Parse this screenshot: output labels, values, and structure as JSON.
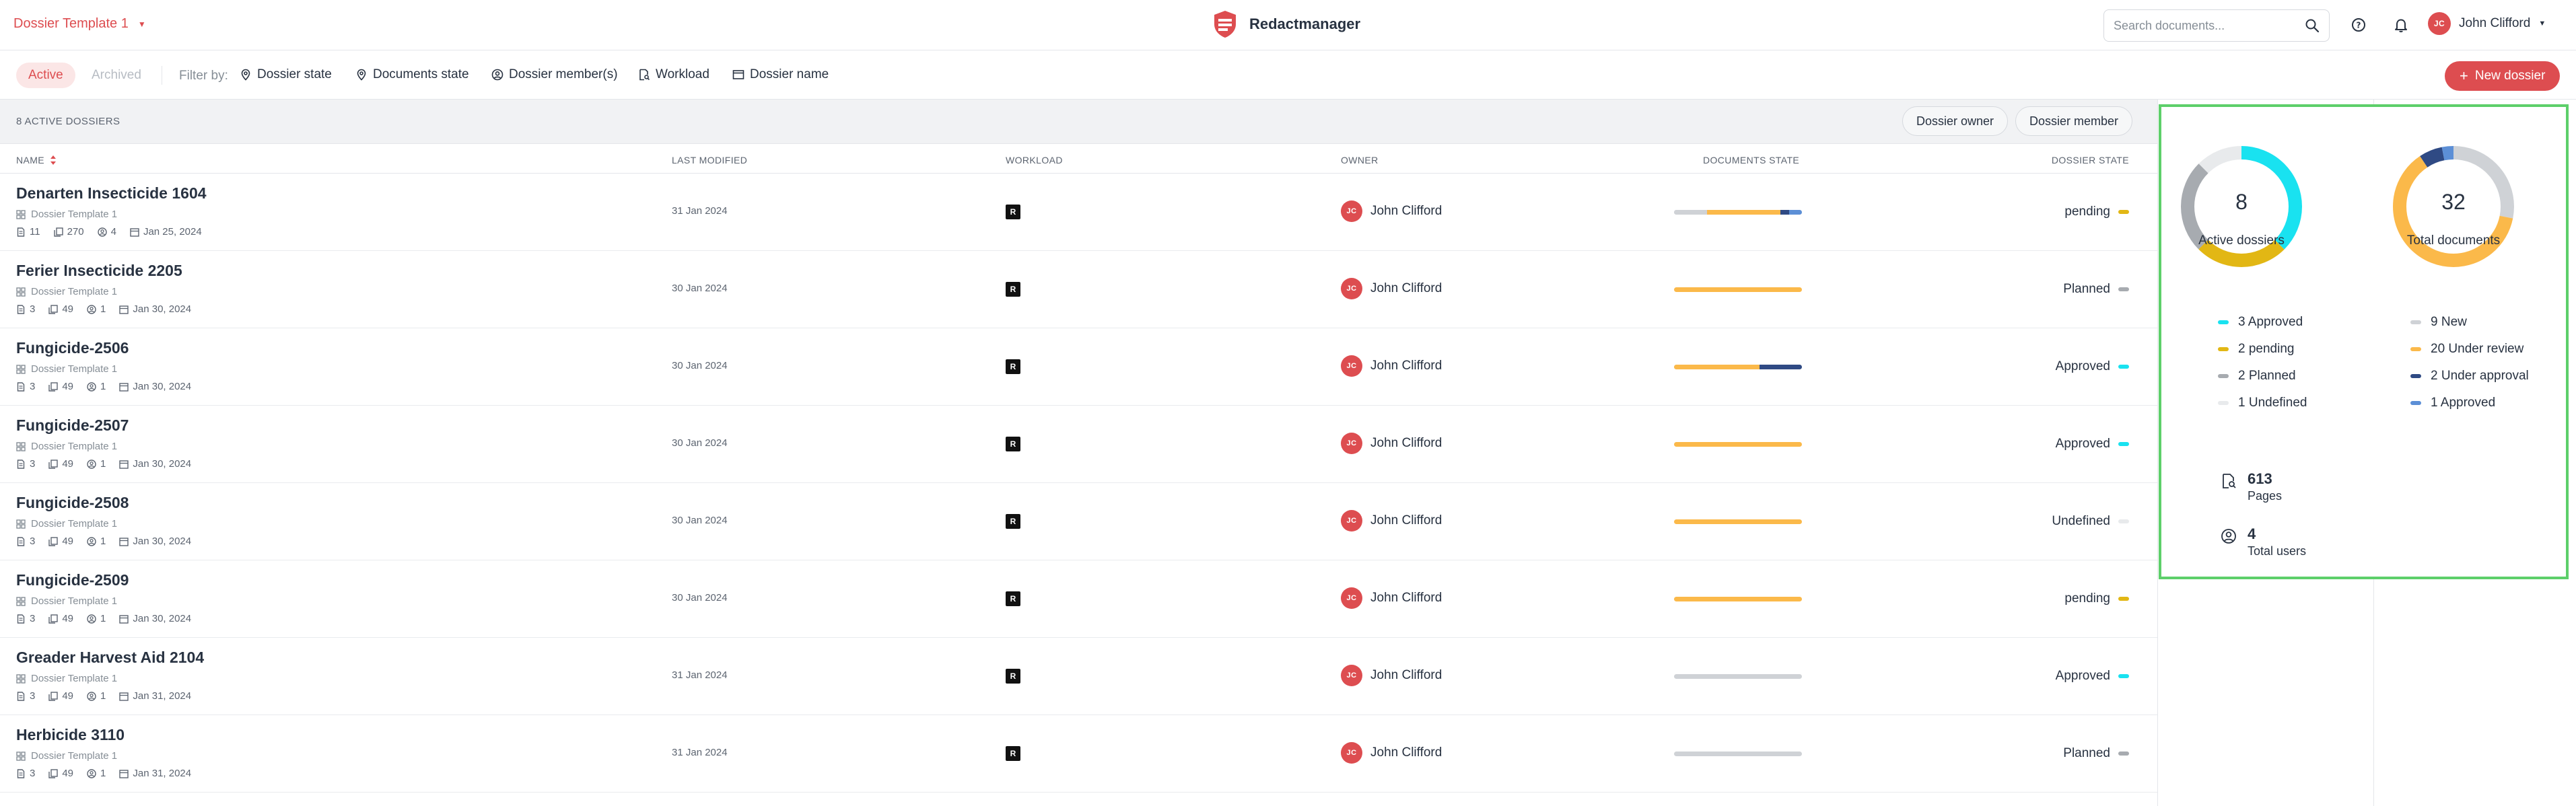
{
  "header": {
    "template_selector": "Dossier Template 1",
    "brand_name": "Redactmanager",
    "search_placeholder": "Search documents...",
    "user_initials": "JC",
    "user_name": "John Clifford"
  },
  "filterbar": {
    "tab_active": "Active",
    "tab_archived": "Archived",
    "filter_label": "Filter by:",
    "filters": [
      "Dossier state",
      "Documents state",
      "Dossier member(s)",
      "Workload",
      "Dossier name"
    ],
    "new_button": "New dossier"
  },
  "table": {
    "count_label": "8 ACTIVE DOSSIERS",
    "btn_owner": "Dossier owner",
    "btn_member": "Dossier member",
    "columns": [
      "NAME",
      "LAST MODIFIED",
      "WORKLOAD",
      "OWNER",
      "DOCUMENTS STATE",
      "DOSSIER STATE"
    ],
    "workload_badge": "R",
    "rows": [
      {
        "name": "Denarten Insecticide 1604",
        "template": "Dossier Template 1",
        "docs": "11",
        "pages": "270",
        "members": "4",
        "date": "Jan 25, 2024",
        "modified": "31 Jan 2024",
        "owner": "John Clifford",
        "owner_initials": "JC",
        "state": "pending",
        "state_color": "#e2b714",
        "bar": [
          [
            "#cfd2d6",
            26
          ],
          [
            "#fbb94a",
            57
          ],
          [
            "#2f4a84",
            7
          ],
          [
            "#5c8fd6",
            10
          ]
        ]
      },
      {
        "name": "Ferier Insecticide 2205",
        "template": "Dossier Template 1",
        "docs": "3",
        "pages": "49",
        "members": "1",
        "date": "Jan 30, 2024",
        "modified": "30 Jan 2024",
        "owner": "John Clifford",
        "owner_initials": "JC",
        "state": "Planned",
        "state_color": "#a7abb0",
        "bar": [
          [
            "#fbb94a",
            100
          ]
        ]
      },
      {
        "name": "Fungicide-2506",
        "template": "Dossier Template 1",
        "docs": "3",
        "pages": "49",
        "members": "1",
        "date": "Jan 30, 2024",
        "modified": "30 Jan 2024",
        "owner": "John Clifford",
        "owner_initials": "JC",
        "state": "Approved",
        "state_color": "#19e2f0",
        "bar": [
          [
            "#fbb94a",
            67
          ],
          [
            "#2f4a84",
            33
          ]
        ]
      },
      {
        "name": "Fungicide-2507",
        "template": "Dossier Template 1",
        "docs": "3",
        "pages": "49",
        "members": "1",
        "date": "Jan 30, 2024",
        "modified": "30 Jan 2024",
        "owner": "John Clifford",
        "owner_initials": "JC",
        "state": "Approved",
        "state_color": "#19e2f0",
        "bar": [
          [
            "#fbb94a",
            100
          ]
        ]
      },
      {
        "name": "Fungicide-2508",
        "template": "Dossier Template 1",
        "docs": "3",
        "pages": "49",
        "members": "1",
        "date": "Jan 30, 2024",
        "modified": "30 Jan 2024",
        "owner": "John Clifford",
        "owner_initials": "JC",
        "state": "Undefined",
        "state_color": "#e8eaec",
        "bar": [
          [
            "#fbb94a",
            100
          ]
        ]
      },
      {
        "name": "Fungicide-2509",
        "template": "Dossier Template 1",
        "docs": "3",
        "pages": "49",
        "members": "1",
        "date": "Jan 30, 2024",
        "modified": "30 Jan 2024",
        "owner": "John Clifford",
        "owner_initials": "JC",
        "state": "pending",
        "state_color": "#e2b714",
        "bar": [
          [
            "#fbb94a",
            100
          ]
        ]
      },
      {
        "name": "Greader Harvest Aid 2104",
        "template": "Dossier Template 1",
        "docs": "3",
        "pages": "49",
        "members": "1",
        "date": "Jan 31, 2024",
        "modified": "31 Jan 2024",
        "owner": "John Clifford",
        "owner_initials": "JC",
        "state": "Approved",
        "state_color": "#19e2f0",
        "bar": [
          [
            "#cfd2d6",
            100
          ]
        ]
      },
      {
        "name": "Herbicide 3110",
        "template": "Dossier Template 1",
        "docs": "3",
        "pages": "49",
        "members": "1",
        "date": "Jan 31, 2024",
        "modified": "31 Jan 2024",
        "owner": "John Clifford",
        "owner_initials": "JC",
        "state": "Planned",
        "state_color": "#a7abb0",
        "bar": [
          [
            "#cfd2d6",
            100
          ]
        ]
      }
    ]
  },
  "stats": {
    "dossiers": {
      "total": "8",
      "label": "Active dossiers",
      "segments": [
        {
          "count": 3,
          "label": "3 Approved",
          "color": "#19e2f0"
        },
        {
          "count": 2,
          "label": "2 pending",
          "color": "#e2b714"
        },
        {
          "count": 2,
          "label": "2 Planned",
          "color": "#a7abb0"
        },
        {
          "count": 1,
          "label": "1 Undefined",
          "color": "#e8eaec"
        }
      ]
    },
    "documents": {
      "total": "32",
      "label": "Total documents",
      "segments": [
        {
          "count": 9,
          "label": "9 New",
          "color": "#cfd2d6"
        },
        {
          "count": 20,
          "label": "20 Under review",
          "color": "#fbb94a"
        },
        {
          "count": 2,
          "label": "2 Under approval",
          "color": "#2f4a84"
        },
        {
          "count": 1,
          "label": "1 Approved",
          "color": "#5c8fd6"
        }
      ]
    },
    "pages": {
      "value": "613",
      "label": "Pages"
    },
    "users": {
      "value": "4",
      "label": "Total users"
    }
  }
}
